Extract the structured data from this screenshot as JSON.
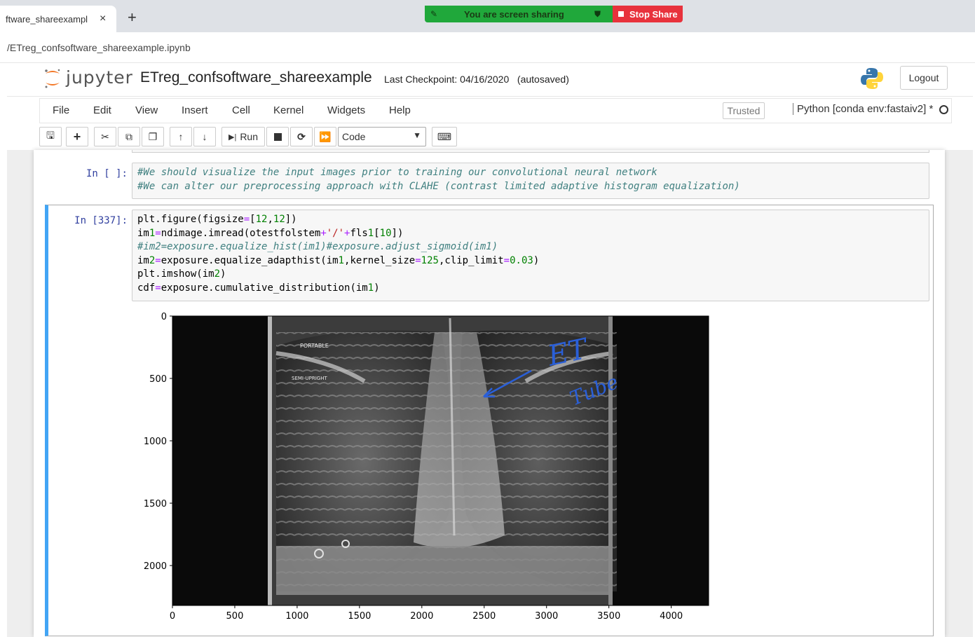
{
  "browser": {
    "tab_title": "ftware_shareexampl",
    "tab_close": "×",
    "new_tab": "+",
    "url": "/ETreg_confsoftware_shareexample.ipynb",
    "share_text": "You are screen sharing",
    "stop_share": "Stop Share"
  },
  "header": {
    "logo_text": "jupyter",
    "notebook_name": "ETreg_confsoftware_shareexample",
    "checkpoint_label": "Last Checkpoint: 04/16/2020",
    "autosaved": "(autosaved)",
    "logout": "Logout"
  },
  "menubar": {
    "items": [
      "File",
      "Edit",
      "View",
      "Insert",
      "Cell",
      "Kernel",
      "Widgets",
      "Help"
    ],
    "trusted": "Trusted",
    "kernel": "Python [conda env:fastaiv2] *"
  },
  "toolbar": {
    "run_label": "Run",
    "cell_type": "Code",
    "icons": [
      "save-icon",
      "plus-icon",
      "cut-icon",
      "copy-icon",
      "paste-icon",
      "arrow-up-icon",
      "arrow-down-icon",
      "run-icon",
      "stop-icon",
      "restart-icon",
      "fast-forward-icon",
      "keyboard-icon"
    ]
  },
  "cells": [
    {
      "prompt": "In [ ]:",
      "lines": [
        "#We should visualize the input images prior to training our convolutional neural network",
        "#We can alter our preprocessing approach with CLAHE (contrast limited adaptive histogram equalization)"
      ]
    },
    {
      "prompt": "In [337]:",
      "lines": [
        "plt.figure(figsize=[12,12])",
        "im1=ndimage.imread(otestfolstem+'/'+fls1[10])",
        "#im2=exposure.equalize_hist(im1)#exposure.adjust_sigmoid(im1)",
        "im2=exposure.equalize_adapthist(im1,kernel_size=125,clip_limit=0.03)",
        "plt.imshow(im2)",
        "cdf=exposure.cumulative_distribution(im1)"
      ]
    }
  ],
  "output_image": {
    "description_labels": [
      "PORTABLE",
      "SEMI-UPRIGHT"
    ],
    "annotation": [
      "ET",
      "Tube"
    ],
    "annotation_color": "#2a5fd8"
  },
  "chart_data": {
    "type": "heatmap",
    "title": "",
    "xlabel": "",
    "ylabel": "",
    "xlim": [
      0,
      4300
    ],
    "ylim": [
      2320,
      0
    ],
    "xticks": [
      0,
      500,
      1000,
      1500,
      2000,
      2500,
      3000,
      3500,
      4000
    ],
    "yticks": [
      0,
      500,
      1000,
      1500,
      2000
    ],
    "grid": false
  }
}
